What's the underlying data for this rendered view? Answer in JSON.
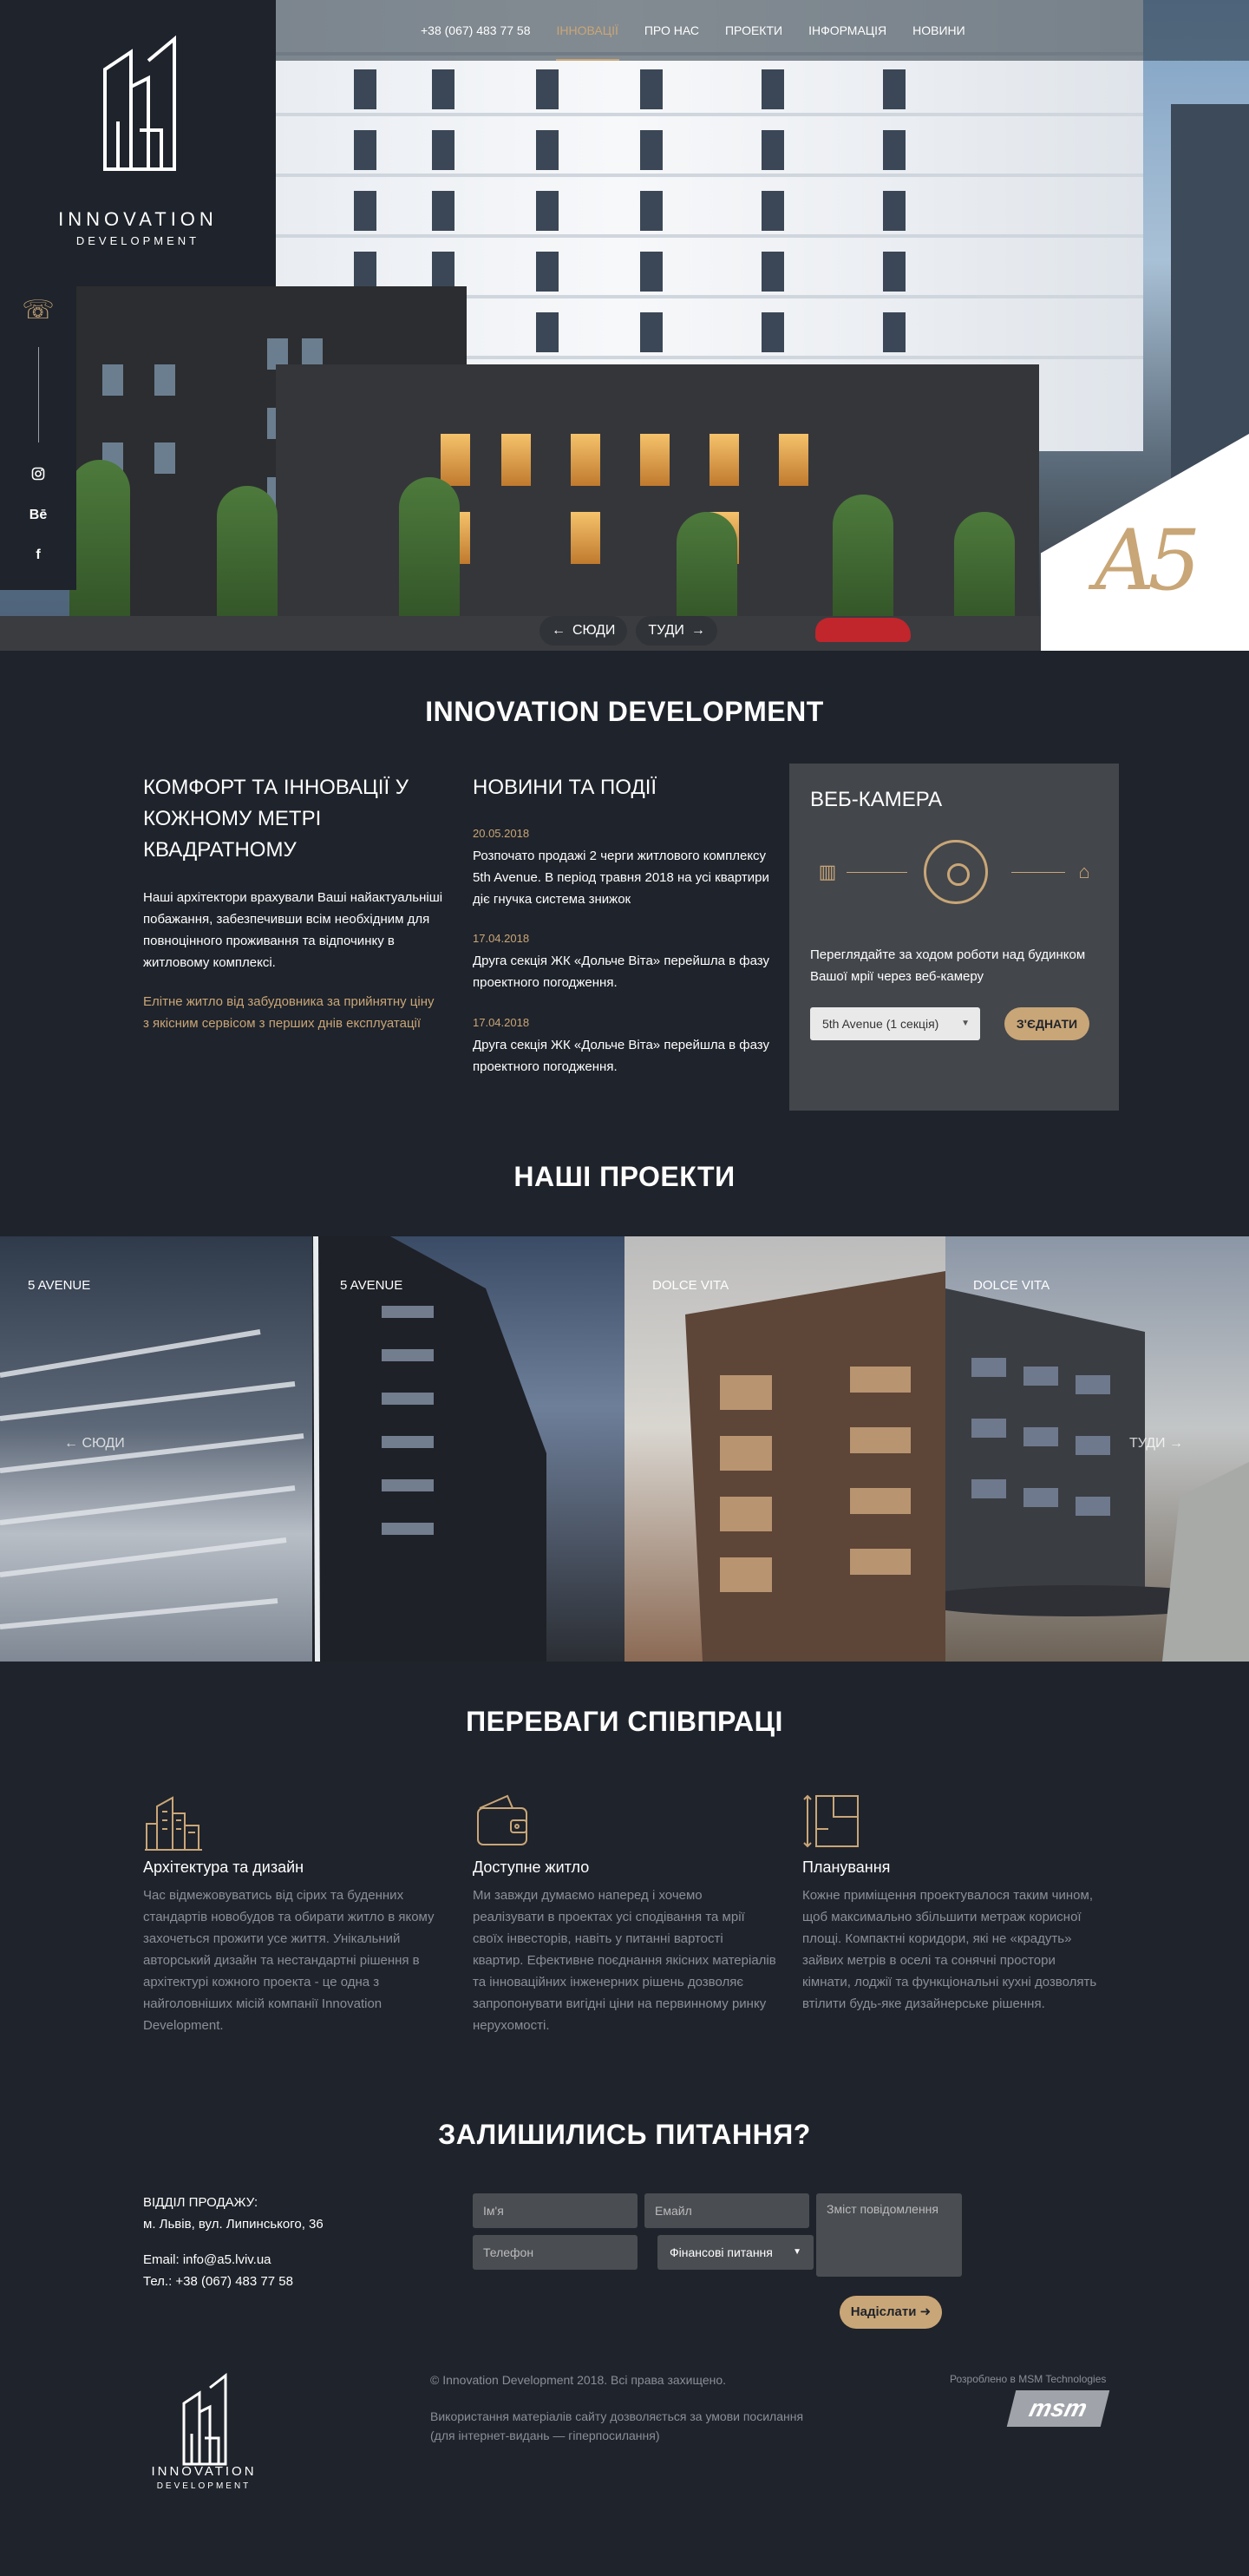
{
  "brand": {
    "name": "INNOVATION",
    "sub": "DEVELOPMENT"
  },
  "nav": {
    "phone": "+38 (067) 483 77 58",
    "items": [
      "ІННОВАЦІЇ",
      "ПРО НАС",
      "ПРОЕКТИ",
      "ІНФОРМАЦІЯ",
      "НОВИНИ"
    ],
    "active_index": 0
  },
  "social": {
    "instagram": "instagram-icon",
    "behance": "Bē",
    "facebook": "f"
  },
  "hero": {
    "prev_label": "СЮДИ",
    "next_label": "ТУДИ",
    "badge": "A5"
  },
  "about": {
    "title": "INNOVATION DEVELOPMENT",
    "heading": "КОМФОРТ ТА ІННОВАЦІЇ У КОЖНОМУ МЕТРІ КВАДРАТНОМУ",
    "text": "Наші архітектори врахували Ваші найактуальніші побажання, забезпечивши всім необхідним для повноцінного проживання та відпочинку в житловому комплексі.",
    "highlight": "Елітне житло від забудовника за прийнятну ціну з якісним сервісом з перших днів експлуатації"
  },
  "news": {
    "heading": "НОВИНИ ТА ПОДІЇ",
    "items": [
      {
        "date": "20.05.2018",
        "text": "Розпочато продажі 2 черги житлового комплексу 5th Avenue. В період травня 2018 на усі квартири діє гнучка система знижок"
      },
      {
        "date": "17.04.2018",
        "text": "Друга секція ЖК «Дольче Віта» перейшла в фазу проектного погодження."
      },
      {
        "date": "17.04.2018",
        "text": "Друга секція ЖК «Дольче Віта» перейшла в фазу проектного погодження."
      }
    ]
  },
  "webcam": {
    "title": "ВЕБ-КАМЕРА",
    "text": "Переглядайте за ходом роботи над будинком Вашої мрії через веб-камеру",
    "select_value": "5th Avenue (1 секція)",
    "connect_label": "З'ЄДНАТИ"
  },
  "projects": {
    "title": "НАШІ ПРОЕКТИ",
    "items": [
      "5 AVENUE",
      "5 AVENUE",
      "DOLCE VITA",
      "DOLCE VITA"
    ],
    "prev_label": "СЮДИ",
    "next_label": "ТУДИ"
  },
  "benefits": {
    "title": "ПЕРЕВАГИ СПІВПРАЦІ",
    "items": [
      {
        "icon": "city-icon",
        "title": "Архітектура та дизайн",
        "text": "Час відмежовуватись від сірих та буденних стандартів новобудов та обирати житло в якому захочеться прожити усе життя. Унікальний авторський дизайн та нестандартні рішення в архітектурі кожного проекта - це одна з найголовніших місій компанії Innovation Development."
      },
      {
        "icon": "wallet-icon",
        "title": "Доступне житло",
        "text": "Ми завжди думаємо наперед і хочемо реалізувати в проектах усі сподівання та мрії своїх інвесторів, навіть у питанні вартості квартир. Ефективне поєднання якісних матеріалів та інноваційних інженерних рішень дозволяє запропонувати вигідні ціни на первинному ринку нерухомості."
      },
      {
        "icon": "floorplan-icon",
        "title": "Планування",
        "text": "Кожне приміщення проектувалося таким чином, щоб максимально збільшити метраж корисної площі. Компактні коридори, які не «крадуть» зайвих метрів в оселі та сонячні простори кімнати, лоджії та функціональні кухні дозволять втілити будь-яке дизайнерське рішення."
      }
    ]
  },
  "contacts": {
    "title": "ЗАЛИШИЛИСЬ ПИТАННЯ?",
    "dept_label": "ВІДДІЛ ПРОДАЖУ:",
    "address": "м. Львів, вул. Липинського, 36",
    "email": "Email: info@a5.lviv.ua",
    "phone": "Тел.: +38 (067) 483 77 58",
    "form": {
      "name_placeholder": "Ім'я",
      "email_placeholder": "Емайл",
      "phone_placeholder": "Телефон",
      "message_placeholder": "Зміст повідомлення",
      "topic_value": "Фінансові питання",
      "submit_label": "Надіслати"
    }
  },
  "footer": {
    "copyright": "© Innovation Development 2018. Всі права захищено.",
    "terms": "Використання матеріалів сайту дозволяється за умови посилання (для інтернет-видань — гіперпосилання)",
    "dev_label": "Розроблено в MSM Technologies",
    "dev_logo": "msm"
  },
  "colors": {
    "accent": "#c9a677",
    "bg": "#1f232b",
    "panel": "#43464b"
  }
}
